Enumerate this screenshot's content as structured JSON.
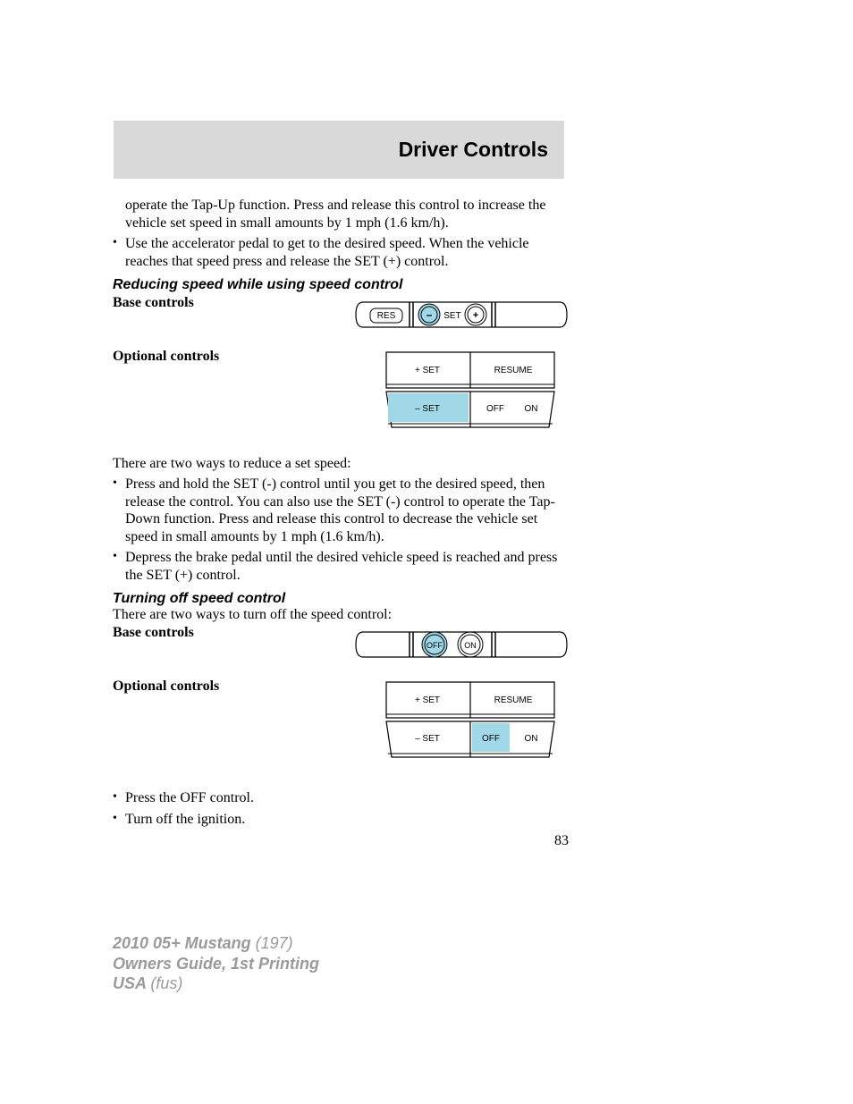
{
  "header": {
    "title": "Driver Controls"
  },
  "body": {
    "intro1": "operate the Tap-Up function. Press and release this control to increase the vehicle set speed in small amounts by 1 mph (1.6 km/h).",
    "intro2": "Use the accelerator pedal to get to the desired speed. When the vehicle reaches that speed press and release the SET (+) control.",
    "sec1_head": "Reducing speed while using speed control",
    "base_label": "Base controls",
    "opt_label": "Optional controls",
    "reduce_intro": "There are two ways to reduce a set speed:",
    "reduce_b1": "Press and hold the SET (-) control until you get to the desired speed, then release the control. You can also use the SET (-) control to operate the Tap-Down function. Press and release this control to decrease the vehicle set speed in small amounts by 1 mph (1.6 km/h).",
    "reduce_b2": "Depress the brake pedal until the desired vehicle speed is reached and press the SET (+) control.",
    "sec2_head": "Turning off speed control",
    "turnoff_intro": "There are two ways to turn off the speed control:",
    "turnoff_b1": "Press the OFF control.",
    "turnoff_b2": "Turn off the ignition."
  },
  "diagrams": {
    "base1": {
      "res": "RES",
      "minus": "–",
      "set": "SET",
      "plus": "+"
    },
    "opt": {
      "set_plus": "+ SET",
      "set_minus": "– SET",
      "resume": "RESUME",
      "off": "OFF",
      "on": "ON"
    },
    "base2": {
      "off": "OFF",
      "on": "ON"
    }
  },
  "page": "83",
  "footer": {
    "l1a": "2010 05+ Mustang ",
    "l1b": "(197)",
    "l2": "Owners Guide, 1st Printing",
    "l3a": "USA ",
    "l3b": "(fus)"
  }
}
